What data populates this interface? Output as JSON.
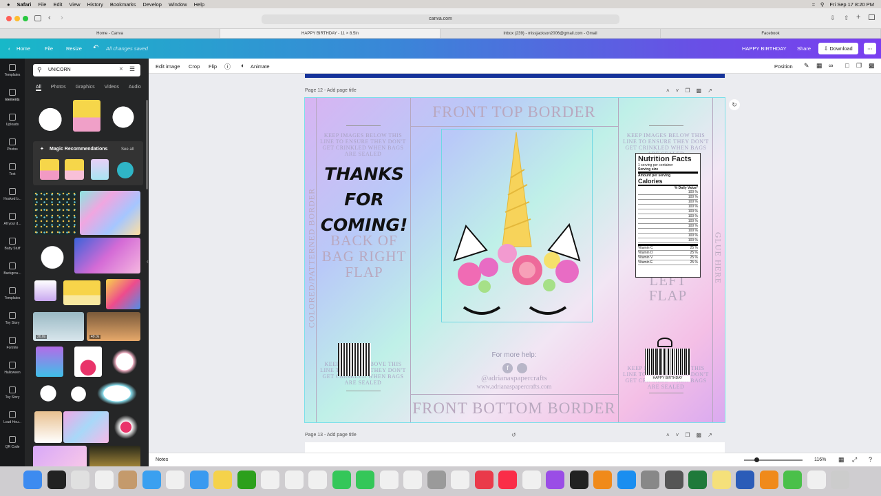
{
  "menubar": {
    "apple": "",
    "items": [
      "Safari",
      "File",
      "Edit",
      "View",
      "History",
      "Bookmarks",
      "Develop",
      "Window",
      "Help"
    ],
    "datetime": "Fri Sep 17  8:20 PM"
  },
  "browser": {
    "url": "canva.com",
    "tabs": [
      "Home - Canva",
      "HAPPY BIRTHDAY - 11 × 8.5in",
      "Inbox (239) - missjackson2006@gmail.com - Gmail",
      "Facebook"
    ]
  },
  "canva": {
    "home": "Home",
    "file": "File",
    "resize": "Resize",
    "saved": "All changes saved",
    "doc_title": "HAPPY BIRTHDAY",
    "share": "Share",
    "download": "Download"
  },
  "rail": [
    "Templates",
    "Elements",
    "Uploads",
    "Photos",
    "Text",
    "Hooked b...",
    "All your d...",
    "Baby Stuff",
    "Backgrou...",
    "Templates",
    "Toy Story",
    "Fortnite",
    "Halloween",
    "Toy Story",
    "Loud Hou...",
    "QR Code"
  ],
  "panel": {
    "search_value": "UNICORN",
    "tabs": [
      "All",
      "Photos",
      "Graphics",
      "Videos",
      "Audio"
    ],
    "magic": "Magic Recommendations",
    "see_all": "See all",
    "video1": "20.0s",
    "video2": "49.0s"
  },
  "toolbar": {
    "edit_image": "Edit image",
    "crop": "Crop",
    "flip": "Flip",
    "animate": "Animate",
    "position": "Position"
  },
  "pages": {
    "p12": "Page 12 - Add page title",
    "p13": "Page 13 - Add page title"
  },
  "design": {
    "front_top": "FRONT TOP BORDER",
    "front_bottom": "FRONT BOTTOM BORDER",
    "keep1": "KEEP IMAGES BELOW THIS LINE TO ENSURE THEY DON'T GET CRINKLED WHEN BAGS ARE SEALED",
    "keep2": "KEEP IMAGES BELOW THIS LINE TO ENSURE THEY DON'T GET CRINKLED WHEN BAGS ARE SEALED",
    "keep3": "KEEP IMAGES ABOVE THIS LINE TO ENSURE THEY DON'T GET CRINKLED WHEN BAGS ARE SEALED",
    "keep4": "KEEP IMAGES ABOVE THIS LINE TO ENSURE THEY DON'T GET CRINKLED WHEN BAGS ARE SEALED",
    "thanks": "THANKS FOR COMING!",
    "back_flap": "BACK OF BAG RIGHT FLAP",
    "left_flap": "LEFT FLAP",
    "colored_border": "COLORED/PATTERNED BORDER",
    "glue": "GLUE HERE",
    "more_help": "For more help:",
    "handle": "@adrianaspapercrafts",
    "website": "www.adrianaspapercrafts.com",
    "nutrition": {
      "title": "Nutrition Facts",
      "serving": "1 serving  per container",
      "serving_size": "Serving size",
      "amount": "Amount per serving",
      "calories": "Calories",
      "dv": "% Daily Value*",
      "pct": "100 %",
      "vitamins": [
        "Vitamin C",
        "Vitamin D",
        "Vitamin V",
        "Vitamin E"
      ],
      "vpct": "25 %"
    },
    "barcode_text": "HAPPY BIRTHDAY"
  },
  "notes": {
    "label": "Notes",
    "zoom": "116%"
  }
}
